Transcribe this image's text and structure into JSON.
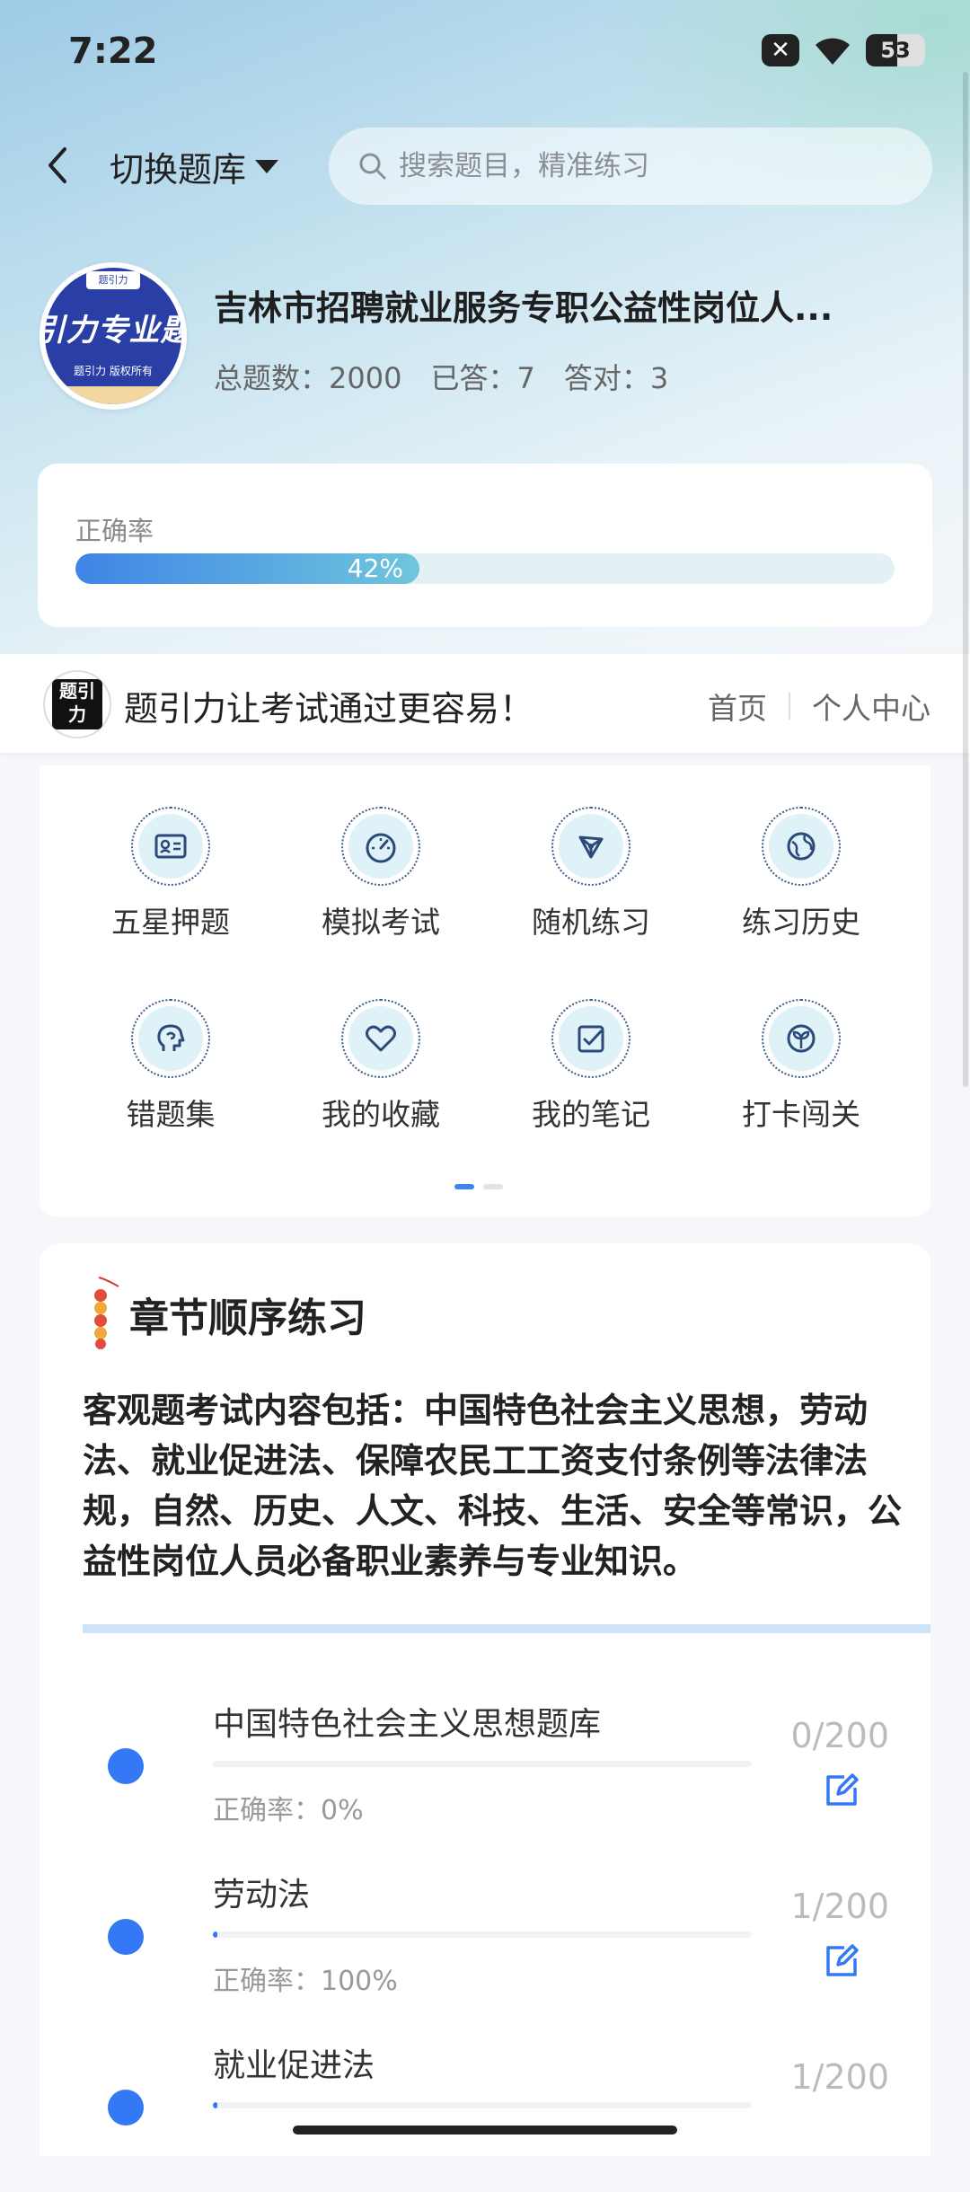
{
  "status_bar": {
    "time": "7:22",
    "battery": "53"
  },
  "header": {
    "switch_label": "切换题库",
    "search_placeholder": "搜索题目，精准练习"
  },
  "bank": {
    "logo_text": "引力专业题",
    "logo_sub": "题引力 版权所有",
    "logo_badge": "题引力",
    "title": "吉林市招聘就业服务专职公益性岗位人...",
    "stats": {
      "total": "总题数：2000",
      "answered": "已答：7",
      "correct": "答对：3"
    }
  },
  "accuracy": {
    "label": "正确率",
    "value_text": "42%",
    "value": 0.42
  },
  "banner": {
    "logo_text": "题引力",
    "slogan": "题引力让考试通过更容易！",
    "link_home": "首页",
    "link_profile": "个人中心"
  },
  "features": [
    {
      "label": "五星押题",
      "icon": "id-card-icon"
    },
    {
      "label": "模拟考试",
      "icon": "speedometer-icon"
    },
    {
      "label": "随机练习",
      "icon": "network-icon"
    },
    {
      "label": "练习历史",
      "icon": "globe-icon"
    },
    {
      "label": "错题集",
      "icon": "head-icon"
    },
    {
      "label": "我的收藏",
      "icon": "heart-icon"
    },
    {
      "label": "我的笔记",
      "icon": "note-check-icon"
    },
    {
      "label": "打卡闯关",
      "icon": "sprout-icon"
    }
  ],
  "chapter": {
    "title": "章节顺序练习",
    "description": "客观题考试内容包括：中国特色社会主义思想，劳动法、就业促进法、保障农民工工资支付条例等法律法规，自然、历史、人文、科技、生活、安全等常识，公益性岗位人员必备职业素养与专业知识。",
    "items": [
      {
        "name": "中国特色社会主义思想题库",
        "accuracy": "正确率：0%",
        "count": "0/200",
        "progress": 0.0
      },
      {
        "name": "劳动法",
        "accuracy": "正确率：100%",
        "count": "1/200",
        "progress": 0.005
      },
      {
        "name": "就业促进法",
        "accuracy": "",
        "count": "1/200",
        "progress": 0.005
      }
    ]
  },
  "colors": {
    "accent": "#3478f6",
    "progress_start": "#3f84e6",
    "progress_end": "#6fc6dc"
  }
}
